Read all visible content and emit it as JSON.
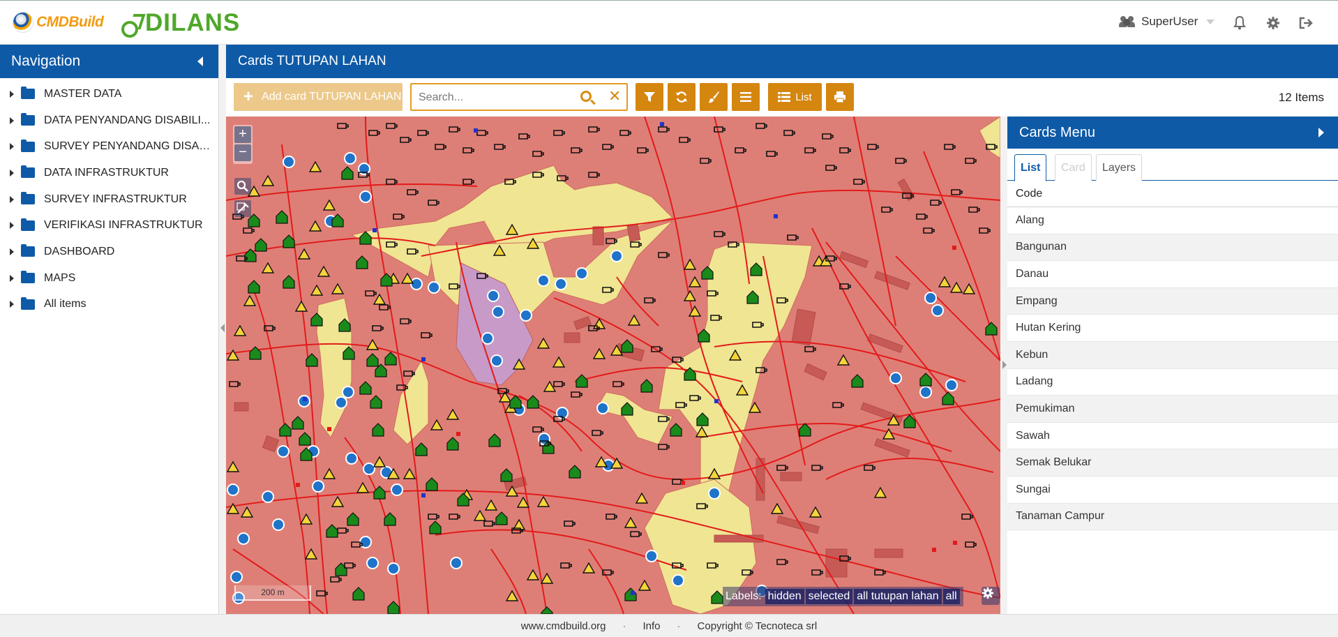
{
  "header": {
    "logo_cmd": "CMDBuild",
    "logo_dilans": "DILANS",
    "user_name": "SuperUser",
    "icons": [
      "users-icon",
      "bell-icon",
      "gear-icon",
      "logout-icon"
    ]
  },
  "nav": {
    "title": "Navigation",
    "items": [
      {
        "label": "MASTER DATA"
      },
      {
        "label": "DATA PENYANDANG DISABILI..."
      },
      {
        "label": "SURVEY PENYANDANG DISABI..."
      },
      {
        "label": "DATA INFRASTRUKTUR"
      },
      {
        "label": "SURVEY INFRASTRUKTUR"
      },
      {
        "label": "VERIFIKASI INFRASTRUKTUR"
      },
      {
        "label": "DASHBOARD"
      },
      {
        "label": "MAPS"
      },
      {
        "label": "All items"
      }
    ]
  },
  "main": {
    "title": "Cards TUTUPAN LAHAN",
    "add_button": "Add card TUTUPAN LAHAN",
    "search_placeholder": "Search...",
    "list_button": "List",
    "items_count": "12 Items"
  },
  "map": {
    "zoom_in": "+",
    "zoom_out": "−",
    "scale": "200 m",
    "labels_title": "Labels:",
    "label_options": [
      "hidden",
      "selected",
      "all tutupan lahan",
      "all"
    ],
    "colors": {
      "pemukiman": "#de7f77",
      "kebun": "#f0e592",
      "danau": "#c89ac8",
      "road": "#e21b1b",
      "poi_warning": "#f5d33a",
      "poi_wheelchair": "#1f73c9",
      "poi_house": "#1a8a1a"
    }
  },
  "cards_menu": {
    "title": "Cards Menu",
    "tabs": [
      "List",
      "Card",
      "Layers"
    ],
    "column": "Code",
    "rows": [
      "Alang",
      "Bangunan",
      "Danau",
      "Empang",
      "Hutan Kering",
      "Kebun",
      "Ladang",
      "Pemukiman",
      "Sawah",
      "Semak Belukar",
      "Sungai",
      "Tanaman Campur"
    ]
  },
  "footer": {
    "site": "www.cmdbuild.org",
    "info": "Info",
    "copyright": "Copyright © Tecnoteca srl"
  }
}
